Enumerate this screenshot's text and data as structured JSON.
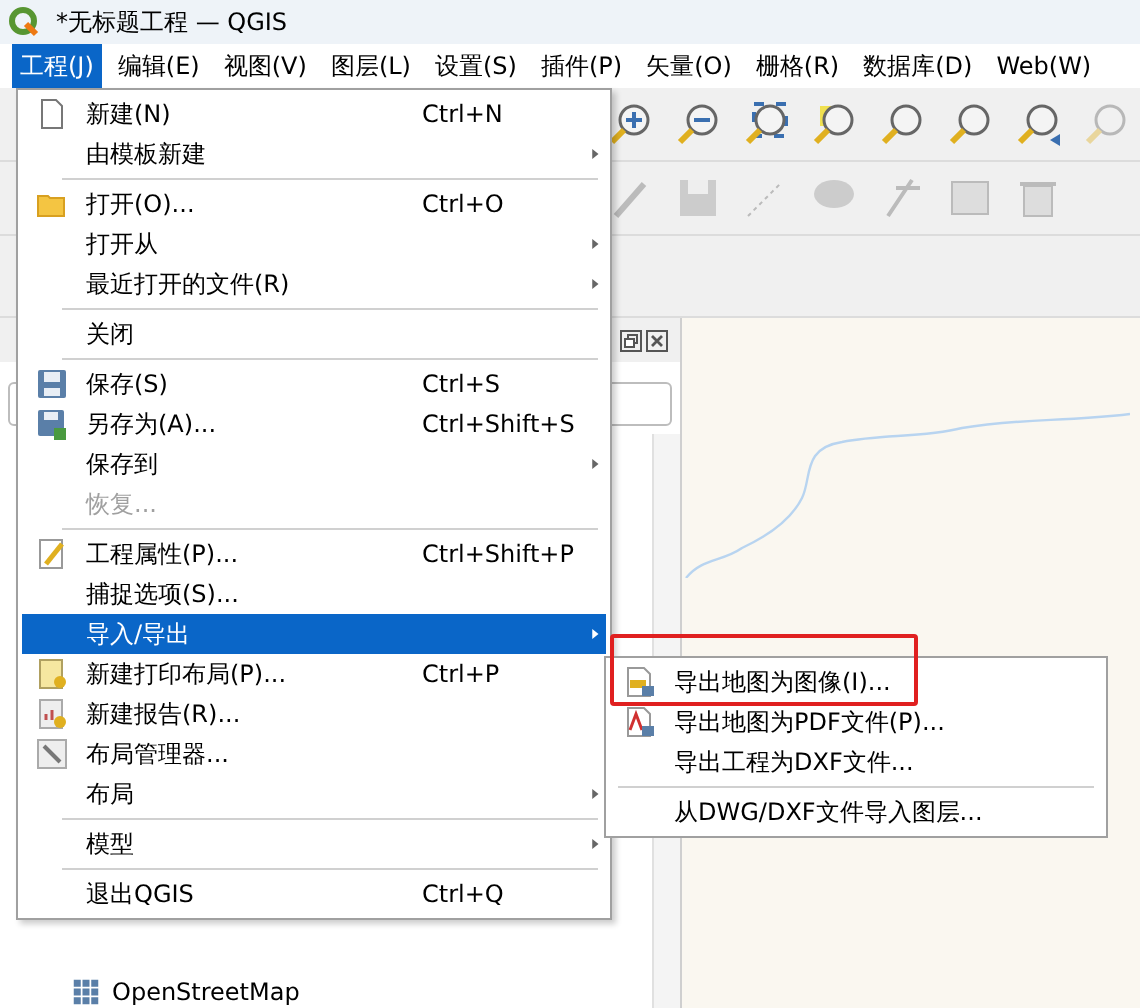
{
  "window": {
    "title": "*无标题工程 — QGIS"
  },
  "menu_bar": [
    {
      "label": "工程(J)",
      "selected": true
    },
    {
      "label": "编辑(E)",
      "selected": false
    },
    {
      "label": "视图(V)",
      "selected": false
    },
    {
      "label": "图层(L)",
      "selected": false
    },
    {
      "label": "设置(S)",
      "selected": false
    },
    {
      "label": "插件(P)",
      "selected": false
    },
    {
      "label": "矢量(O)",
      "selected": false
    },
    {
      "label": "栅格(R)",
      "selected": false
    },
    {
      "label": "数据库(D)",
      "selected": false
    },
    {
      "label": "Web(W)",
      "selected": false
    }
  ],
  "project_menu": [
    {
      "kind": "item",
      "label": "新建(N)",
      "shortcut": "Ctrl+N",
      "submenu": false,
      "disabled": false,
      "selected": false
    },
    {
      "kind": "item",
      "label": "由模板新建",
      "submenu": true,
      "disabled": false,
      "selected": false
    },
    {
      "kind": "separator"
    },
    {
      "kind": "item",
      "label": "打开(O)...",
      "shortcut": "Ctrl+O",
      "submenu": false,
      "disabled": false,
      "selected": false
    },
    {
      "kind": "item",
      "label": "打开从",
      "submenu": true,
      "disabled": false,
      "selected": false
    },
    {
      "kind": "item",
      "label": "最近打开的文件(R)",
      "submenu": true,
      "disabled": false,
      "selected": false
    },
    {
      "kind": "separator"
    },
    {
      "kind": "item",
      "label": "关闭",
      "submenu": false,
      "disabled": false,
      "selected": false
    },
    {
      "kind": "separator"
    },
    {
      "kind": "item",
      "label": "保存(S)",
      "shortcut": "Ctrl+S",
      "submenu": false,
      "disabled": false,
      "selected": false
    },
    {
      "kind": "item",
      "label": "另存为(A)...",
      "shortcut": "Ctrl+Shift+S",
      "submenu": false,
      "disabled": false,
      "selected": false
    },
    {
      "kind": "item",
      "label": "保存到",
      "submenu": true,
      "disabled": false,
      "selected": false
    },
    {
      "kind": "item",
      "label": "恢复...",
      "submenu": false,
      "disabled": true,
      "selected": false
    },
    {
      "kind": "separator"
    },
    {
      "kind": "item",
      "label": "工程属性(P)...",
      "shortcut": "Ctrl+Shift+P",
      "submenu": false,
      "disabled": false,
      "selected": false
    },
    {
      "kind": "item",
      "label": "捕捉选项(S)...",
      "submenu": false,
      "disabled": false,
      "selected": false
    },
    {
      "kind": "item",
      "label": "导入/导出",
      "submenu": true,
      "disabled": false,
      "selected": true
    },
    {
      "kind": "item",
      "label": "新建打印布局(P)...",
      "shortcut": "Ctrl+P",
      "submenu": false,
      "disabled": false,
      "selected": false
    },
    {
      "kind": "item",
      "label": "新建报告(R)...",
      "submenu": false,
      "disabled": false,
      "selected": false
    },
    {
      "kind": "item",
      "label": "布局管理器...",
      "submenu": false,
      "disabled": false,
      "selected": false
    },
    {
      "kind": "item",
      "label": "布局",
      "submenu": true,
      "disabled": false,
      "selected": false
    },
    {
      "kind": "separator"
    },
    {
      "kind": "item",
      "label": "模型",
      "submenu": true,
      "disabled": false,
      "selected": false
    },
    {
      "kind": "separator"
    },
    {
      "kind": "item",
      "label": "退出QGIS",
      "shortcut": "Ctrl+Q",
      "submenu": false,
      "disabled": false,
      "selected": false
    }
  ],
  "import_export_submenu": [
    {
      "kind": "item",
      "label": "导出地图为图像(I)...",
      "highlighted": true
    },
    {
      "kind": "item",
      "label": "导出地图为PDF文件(P)...",
      "highlighted": false
    },
    {
      "kind": "item",
      "label": "导出工程为DXF文件...",
      "highlighted": false
    },
    {
      "kind": "separator"
    },
    {
      "kind": "item",
      "label": "从DWG/DXF文件导入图层...",
      "highlighted": false
    }
  ],
  "browser_panel": {
    "items": [
      {
        "label": "OpenStreetMap"
      }
    ]
  }
}
